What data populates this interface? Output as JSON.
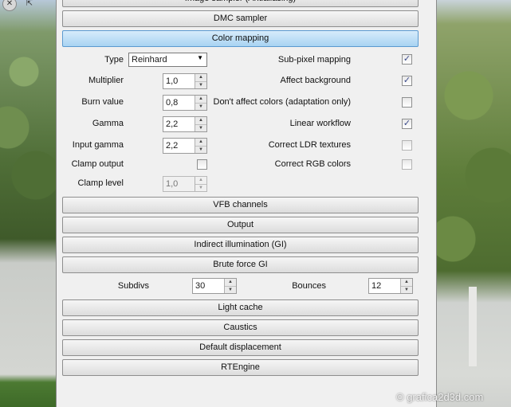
{
  "rollouts_top": {
    "image_sampler": "Image sampler (Antialiasing)",
    "dmc_sampler": "DMC sampler",
    "color_mapping": "Color mapping"
  },
  "color_mapping": {
    "type_label": "Type",
    "type_value": "Reinhard",
    "multiplier_label": "Multiplier",
    "multiplier_value": "1,0",
    "burn_label": "Burn value",
    "burn_value": "0,8",
    "gamma_label": "Gamma",
    "gamma_value": "2,2",
    "input_gamma_label": "Input gamma",
    "input_gamma_value": "2,2",
    "clamp_output_label": "Clamp output",
    "clamp_level_label": "Clamp level",
    "clamp_level_value": "1,0",
    "subpixel_label": "Sub-pixel mapping",
    "affect_bg_label": "Affect background",
    "dont_affect_label": "Don't affect colors (adaptation only)",
    "linear_workflow_label": "Linear workflow",
    "correct_ldr_label": "Correct LDR textures",
    "correct_rgb_label": "Correct RGB colors",
    "checked_glyph": "✓"
  },
  "rollouts_mid": {
    "vfb_channels": "VFB channels",
    "output": "Output",
    "indirect": "Indirect illumination (GI)",
    "brute_force": "Brute force GI"
  },
  "brute_force": {
    "subdivs_label": "Subdivs",
    "subdivs_value": "30",
    "bounces_label": "Bounces",
    "bounces_value": "12"
  },
  "rollouts_bottom": {
    "light_cache": "Light cache",
    "caustics": "Caustics",
    "default_displacement": "Default displacement",
    "rtengine": "RTEngine"
  },
  "watermark": "© grafica2d3d.com",
  "spinner_glyphs": {
    "up": "▲",
    "down": "▼"
  },
  "dropdown_glyph": "▼",
  "top_icons": {
    "close": "✕",
    "cursor": "⇱"
  },
  "colors": {
    "active_rollout": "#a8d3f2",
    "panel_bg": "#f0f0f0",
    "check": "#3b4a8a"
  }
}
